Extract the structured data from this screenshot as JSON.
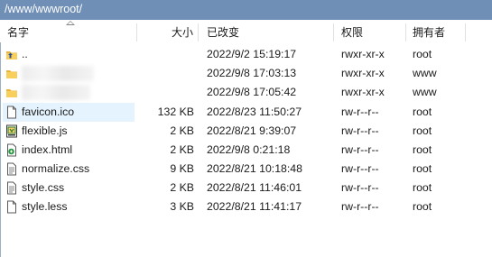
{
  "path": "/www/wwwroot/",
  "columns": {
    "name": "名字",
    "size": "大小",
    "modified": "已改变",
    "permissions": "权限",
    "owner": "拥有者"
  },
  "rows": [
    {
      "icon": "folder-up-icon",
      "name": "..",
      "size": "",
      "modified": "2022/9/2 15:19:17",
      "permissions": "rwxr-xr-x",
      "owner": "root"
    },
    {
      "icon": "folder-icon",
      "name": "",
      "size": "",
      "modified": "2022/9/8 17:03:13",
      "permissions": "rwxr-xr-x",
      "owner": "www"
    },
    {
      "icon": "folder-icon",
      "name": "",
      "size": "",
      "modified": "2022/9/8 17:05:42",
      "permissions": "rwxr-xr-x",
      "owner": "www"
    },
    {
      "icon": "file-icon",
      "name": "favicon.ico",
      "size": "132 KB",
      "modified": "2022/8/23 11:50:27",
      "permissions": "rw-r--r--",
      "owner": "root"
    },
    {
      "icon": "js-file-icon",
      "name": "flexible.js",
      "size": "2 KB",
      "modified": "2022/8/21 9:39:07",
      "permissions": "rw-r--r--",
      "owner": "root"
    },
    {
      "icon": "html-file-icon",
      "name": "index.html",
      "size": "2 KB",
      "modified": "2022/9/8 0:21:18",
      "permissions": "rw-r--r--",
      "owner": "root"
    },
    {
      "icon": "text-file-icon",
      "name": "normalize.css",
      "size": "9 KB",
      "modified": "2022/8/21 10:18:48",
      "permissions": "rw-r--r--",
      "owner": "root"
    },
    {
      "icon": "text-file-icon",
      "name": "style.css",
      "size": "2 KB",
      "modified": "2022/8/21 11:46:01",
      "permissions": "rw-r--r--",
      "owner": "root"
    },
    {
      "icon": "file-icon",
      "name": "style.less",
      "size": "3 KB",
      "modified": "2022/8/21 11:41:17",
      "permissions": "rw-r--r--",
      "owner": "root"
    }
  ]
}
